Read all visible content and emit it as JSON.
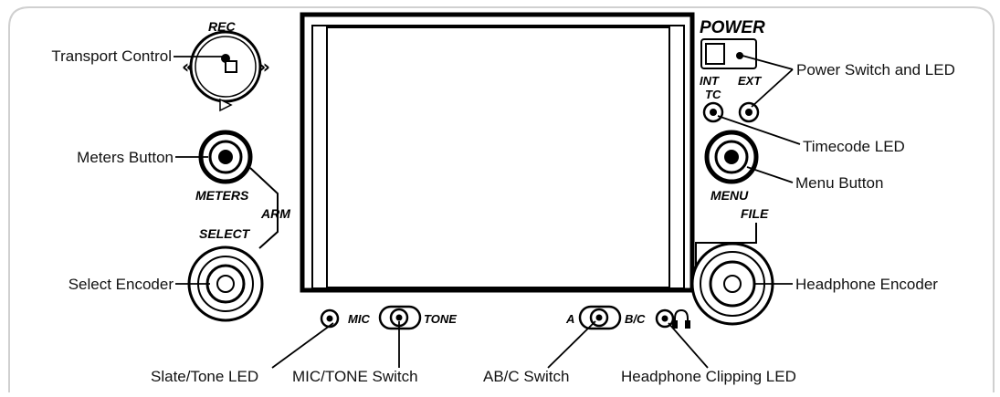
{
  "device_labels": {
    "rec": "REC",
    "power": "POWER",
    "int": "INT",
    "ext": "EXT",
    "tc": "TC",
    "meters": "METERS",
    "arm": "ARM",
    "select": "SELECT",
    "menu": "MENU",
    "file": "FILE",
    "mic": "MIC",
    "tone": "TONE",
    "a": "A",
    "bc": "B/C"
  },
  "callouts": {
    "transport_control": "Transport Control",
    "meters_button": "Meters Button",
    "select_encoder": "Select Encoder",
    "power_switch_led": "Power Switch and LED",
    "timecode_led": "Timecode LED",
    "menu_button": "Menu Button",
    "headphone_encoder": "Headphone Encoder",
    "slate_tone_led": "Slate/Tone LED",
    "mic_tone_switch": "MIC/TONE Switch",
    "abc_switch": "AB/C Switch",
    "headphone_clipping_led": "Headphone Clipping LED"
  },
  "colors": {
    "outline": "#000000",
    "frame": "#d0d0d0",
    "background": "#ffffff"
  }
}
